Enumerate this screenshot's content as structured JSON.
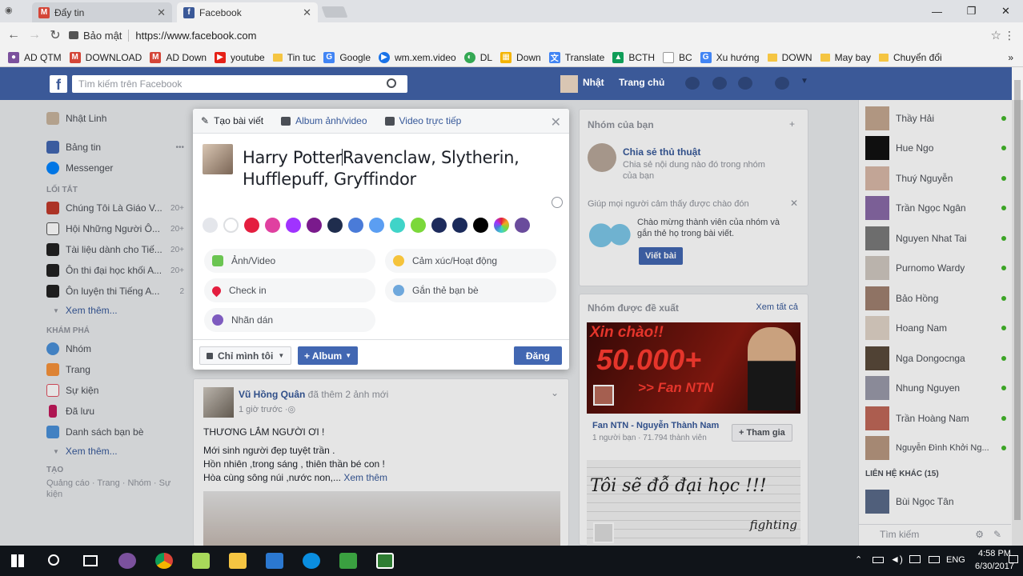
{
  "browser": {
    "tabs": [
      {
        "favicon": "gmail-icon",
        "title": "Đẩy tin",
        "active": false
      },
      {
        "favicon": "facebook-icon",
        "title": "Facebook",
        "active": true
      }
    ],
    "security_label": "Bảo mật",
    "url": "https://www.facebook.com",
    "bookmarks": [
      {
        "icon": "viber-icon",
        "label": "AD QTM"
      },
      {
        "icon": "gmail-icon",
        "label": "DOWNLOAD"
      },
      {
        "icon": "gmail-icon",
        "label": "AD Down"
      },
      {
        "icon": "youtube-icon",
        "label": "youtube"
      },
      {
        "icon": "folder-icon",
        "label": "Tin tuc"
      },
      {
        "icon": "google-icon",
        "label": "Google"
      },
      {
        "icon": "play-icon",
        "label": "wm.xem.video"
      },
      {
        "icon": "dl-icon",
        "label": "DL"
      },
      {
        "icon": "grid-icon",
        "label": "Down"
      },
      {
        "icon": "translate-icon",
        "label": "Translate"
      },
      {
        "icon": "drive-icon",
        "label": "BCTH"
      },
      {
        "icon": "page-icon",
        "label": "BC"
      },
      {
        "icon": "google-icon",
        "label": "Xu hướng"
      },
      {
        "icon": "folder-icon",
        "label": "DOWN"
      },
      {
        "icon": "folder-icon",
        "label": "May bay"
      },
      {
        "icon": "folder-icon",
        "label": "Chuyển đổi"
      }
    ]
  },
  "fb_header": {
    "search_placeholder": "Tìm kiếm trên Facebook",
    "profile_name": "Nhật",
    "home_label": "Trang chủ"
  },
  "left_nav": {
    "profile": "Nhật Linh",
    "main": [
      {
        "label": "Bảng tin",
        "icon": "newsfeed-icon",
        "color": "#4267b2"
      },
      {
        "label": "Messenger",
        "icon": "messenger-icon",
        "color": "#0084ff"
      }
    ],
    "shortcuts_title": "LỐI TẮT",
    "shortcuts": [
      {
        "label": "Chúng Tôi Là Giáo V...",
        "count": "20+",
        "color": "#c0392b"
      },
      {
        "label": "Hội Những Người Ô...",
        "count": "20+",
        "color": "#555555"
      },
      {
        "label": "Tài liệu dành cho Tiế...",
        "count": "20+",
        "color": "#222222"
      },
      {
        "label": "Ôn thi đại học khối A...",
        "count": "20+",
        "color": "#222222"
      },
      {
        "label": "Ôn luyện thi Tiếng A...",
        "count": "2",
        "color": "#222222"
      }
    ],
    "see_more_1": "Xem thêm...",
    "explore_title": "KHÁM PHÁ",
    "explore": [
      {
        "label": "Nhóm",
        "color": "#4a90d9"
      },
      {
        "label": "Trang",
        "color": "#f7923a"
      },
      {
        "label": "Sự kiện",
        "color": "#e04f5f"
      },
      {
        "label": "Đã lưu",
        "color": "#c2185b"
      },
      {
        "label": "Danh sách bạn bè",
        "color": "#4a90d9"
      }
    ],
    "see_more_2": "Xem thêm...",
    "create_title": "TẠO",
    "create_links": "Quảng cáo · Trang · Nhóm · Sự kiện"
  },
  "composer": {
    "tab_create": "Tạo bài viết",
    "tab_album": "Album ảnh/video",
    "tab_live": "Video trực tiếp",
    "text_before_cursor": "Harry Potter",
    "text_after_cursor": "Ravenclaw, Slytherin, Hufflepuff, Gryffindor",
    "background_colors": [
      "#e4e6eb",
      "#ffffff",
      "#e41e3f",
      "#e040a0",
      "#a033ff",
      "#7a1a8c",
      "#1f2d4d",
      "#4a7bd8",
      "#5b9ef2",
      "#40d4c8",
      "#7bd83a",
      "#1d2b5c",
      "#1a2a5a",
      "#000000",
      "#f5a623",
      "#6a4c9c"
    ],
    "options": [
      {
        "label": "Ảnh/Video",
        "icon": "photo-icon",
        "color": "#6bc552"
      },
      {
        "label": "Cảm xúc/Hoạt động",
        "icon": "feeling-icon",
        "color": "#f5c33b"
      },
      {
        "label": "Check in",
        "icon": "location-pin-icon",
        "color": "#e41e3f"
      },
      {
        "label": "Gắn thẻ bạn bè",
        "icon": "tag-friends-icon",
        "color": "#6fa8dc"
      },
      {
        "label": "Nhãn dán",
        "icon": "sticker-icon",
        "color": "#7e5bbf"
      }
    ],
    "privacy_label": "Chỉ mình tôi",
    "album_label": "+ Album",
    "post_label": "Đăng"
  },
  "feed_post": {
    "author": "Vũ Hồng Quân",
    "action": "đã thêm 2 ảnh mới",
    "time": "1 giờ trước",
    "headline": "THƯƠNG LẮM NGƯỜI ƠI !",
    "lines": [
      "Mới sinh người đẹp tuyệt trần .",
      "Hồn nhiên ,trong sáng , thiên thần bé con !",
      "Hòa cùng sông núi ,nước non,..."
    ],
    "see_more": "Xem thêm"
  },
  "right_groups": {
    "title": "Nhóm của bạn",
    "group_name": "Chia sẻ thủ thuật",
    "group_desc": "Chia sẻ nội dung nào đó trong nhóm của bạn",
    "welcome_title": "Giúp mọi người cảm thấy được chào đón",
    "welcome_text": "Chào mừng thành viên của nhóm và gắn thẻ họ trong bài viết.",
    "write_post": "Viết bài"
  },
  "suggested_groups": {
    "title": "Nhóm được đề xuất",
    "see_all": "Xem tất cả",
    "banner_line1": "Xin chào!!",
    "banner_line2": "50.000+",
    "banner_line3": ">> Fan NTN",
    "group_name": "Fan NTN - Nguyễn Thành Nam",
    "members": "1 người bạn · 71.794 thành viên",
    "join": "+ Tham gia",
    "handwriting": "Tôi sẽ đỗ đại học !!!",
    "handwriting_2": "fighting"
  },
  "contacts": {
    "list": [
      "Thầy Hải",
      "Hue Ngo",
      "Thuý Nguyễn",
      "Trần Ngọc Ngân",
      "Nguyen Nhat Tai",
      "Purnomo Wardy",
      "Bảo Hồng",
      "Hoang Nam",
      "Nga Dongocnga",
      "Nhung Nguyen",
      "Trần Hoàng Nam",
      "Nguyễn Đình Khởi Ng..."
    ],
    "others_title": "LIÊN HỆ KHÁC (15)",
    "other_contact": "Bùi Ngọc Tân",
    "search_placeholder": "Tìm kiếm"
  },
  "taskbar": {
    "language": "ENG",
    "time": "4:58 PM",
    "date": "6/30/2017"
  }
}
